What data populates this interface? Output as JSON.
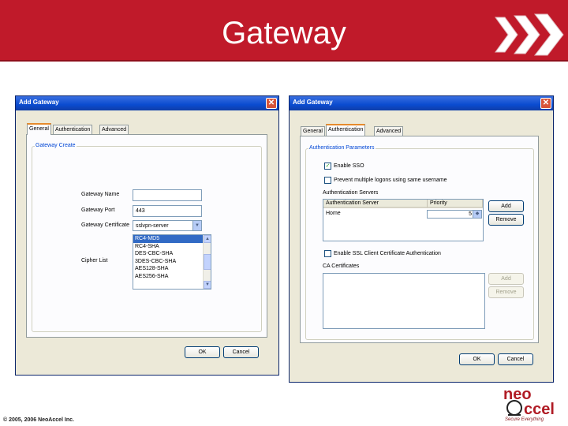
{
  "slide": {
    "title": "Gateway",
    "copyright": "© 2005, 2006 NeoAccel Inc.",
    "logo_text_top": "neo",
    "logo_text_bottom": "ccel",
    "logo_tagline": "Secure Everything",
    "accent_color": "#c01a2a"
  },
  "left_dialog": {
    "title": "Add Gateway",
    "tabs": [
      {
        "label": "General",
        "active": true
      },
      {
        "label": "Authentication",
        "active": false
      },
      {
        "label": "Advanced",
        "active": false
      }
    ],
    "group_title": "Gateway Create",
    "fields": {
      "name_label": "Gateway Name",
      "name_value": "",
      "port_label": "Gateway Port",
      "port_value": "443",
      "certificate_label": "Gateway Certificate",
      "certificate_value": "sslvpn-server",
      "cipher_label": "Cipher List"
    },
    "cipher_options": [
      {
        "label": "RC4-MD5",
        "selected": true
      },
      {
        "label": "RC4-SHA",
        "selected": false
      },
      {
        "label": "DES-CBC-SHA",
        "selected": false
      },
      {
        "label": "3DES-CBC-SHA",
        "selected": false
      },
      {
        "label": "AES128-SHA",
        "selected": false
      },
      {
        "label": "AES256-SHA",
        "selected": false
      }
    ],
    "ok_label": "OK",
    "cancel_label": "Cancel"
  },
  "right_dialog": {
    "title": "Add Gateway",
    "tabs": [
      {
        "label": "General",
        "active": false
      },
      {
        "label": "Authentication",
        "active": true
      },
      {
        "label": "Advanced",
        "active": false
      }
    ],
    "group_title": "Authentication Parameters",
    "check_sso": {
      "label": "Enable SSO",
      "checked": true
    },
    "check_prevent": {
      "label": "Prevent multiple logons using same username",
      "checked": false
    },
    "servers_label": "Authentication Servers",
    "servers_columns": [
      "Authentication Server",
      "Priority"
    ],
    "servers_rows": [
      {
        "server": "Home",
        "priority": "5"
      }
    ],
    "add_label": "Add",
    "remove_label": "Remove",
    "check_ssl": {
      "label": "Enable SSL Client Certificate Authentication",
      "checked": false
    },
    "ca_label": "CA Certificates",
    "ca_add_label": "Add",
    "ca_remove_label": "Remove",
    "ok_label": "OK",
    "cancel_label": "Cancel"
  }
}
